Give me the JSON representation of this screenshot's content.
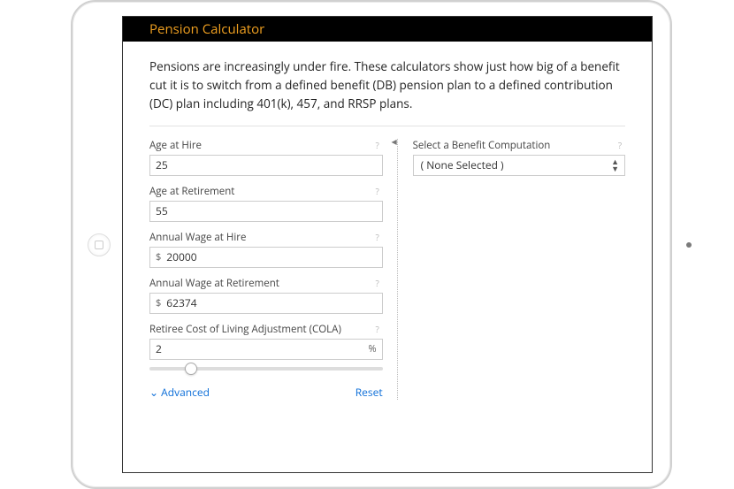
{
  "header": {
    "title": "Pension Calculator"
  },
  "intro": "Pensions are increasingly under fire. These calculators show just how big of a benefit cut it is to switch from a defined benefit (DB) pension plan to a defined contribution (DC) plan including 401(k), 457, and RRSP plans.",
  "left": {
    "fields": [
      {
        "label": "Age at Hire",
        "value": "25",
        "prefix": "",
        "suffix": ""
      },
      {
        "label": "Age at Retirement",
        "value": "55",
        "prefix": "",
        "suffix": ""
      },
      {
        "label": "Annual Wage at Hire",
        "value": "20000",
        "prefix": "$",
        "suffix": ""
      },
      {
        "label": "Annual Wage at Retirement",
        "value": "62374",
        "prefix": "$",
        "suffix": ""
      },
      {
        "label": "Retiree Cost of Living Adjustment (COLA)",
        "value": "2",
        "prefix": "",
        "suffix": "%",
        "slider": true
      }
    ],
    "actions": {
      "advanced": "Advanced",
      "reset": "Reset"
    }
  },
  "right": {
    "label": "Select a Benefit Computation",
    "selected": "( None Selected )"
  }
}
